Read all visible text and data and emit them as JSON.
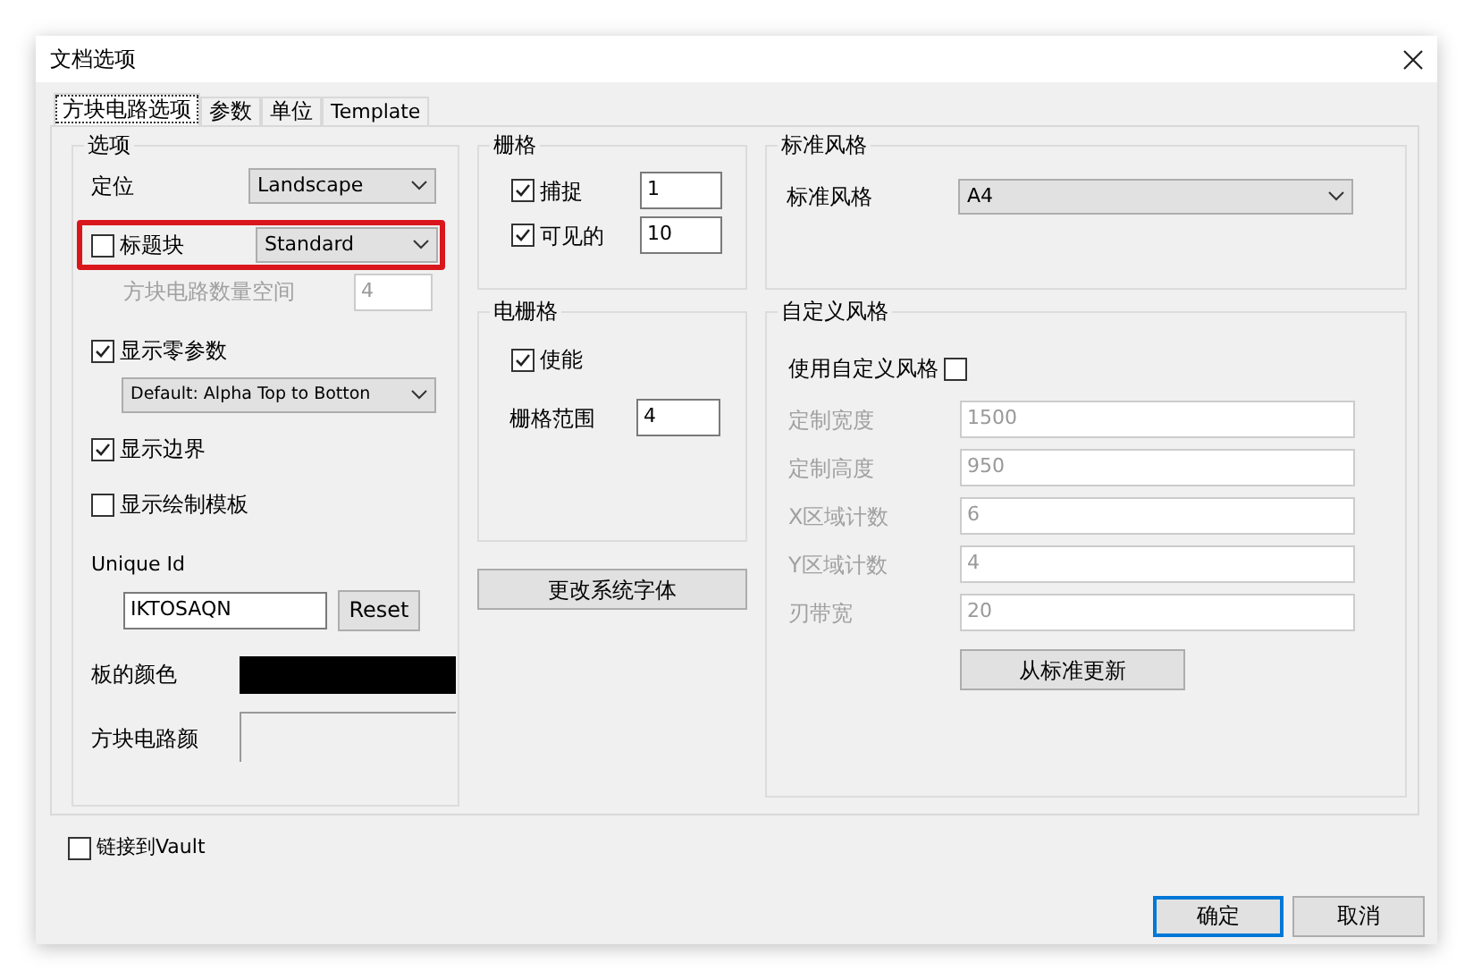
{
  "window": {
    "title": "文档选项"
  },
  "tabs": [
    {
      "label": "方块电路选项",
      "selected": true
    },
    {
      "label": "参数",
      "selected": false
    },
    {
      "label": "单位",
      "selected": false
    },
    {
      "label": "Template",
      "selected": false
    }
  ],
  "options": {
    "title": "选项",
    "orientation": {
      "label": "定位",
      "value": "Landscape"
    },
    "title_block": {
      "label": "标题块",
      "checked": false,
      "value": "Standard",
      "highlighted": true
    },
    "sheet_number_spaces": {
      "label": "方块电路数量空间",
      "value": "4",
      "disabled": true
    },
    "show_zero_params": {
      "label": "显示零参数",
      "checked": true
    },
    "param_order": {
      "value": "Default: Alpha Top to Botton"
    },
    "show_border": {
      "label": "显示边界",
      "checked": true
    },
    "show_template": {
      "label": "显示绘制模板",
      "checked": false
    },
    "unique_id": {
      "label": "Unique Id",
      "value": "IKTOSAQN",
      "button": "Reset"
    },
    "board_color": {
      "label": "板的颜色",
      "color": "#000000"
    },
    "sheet_color": {
      "label": "方块电路颜"
    }
  },
  "grid": {
    "title": "栅格",
    "rows": [
      {
        "label": "捕捉",
        "checked": true,
        "value": "1"
      },
      {
        "label": "可见的",
        "checked": true,
        "value": "10"
      }
    ]
  },
  "electrical_grid": {
    "title": "电栅格",
    "enable": {
      "label": "使能",
      "checked": true
    },
    "range": {
      "label": "栅格范围",
      "value": "4"
    }
  },
  "change_font_button": "更改系统字体",
  "standard_style": {
    "title": "标准风格",
    "label": "标准风格",
    "value": "A4"
  },
  "custom_style": {
    "title": "自定义风格",
    "use_custom": {
      "label": "使用自定义风格",
      "checked": false
    },
    "fields": [
      {
        "label": "定制宽度",
        "value": "1500",
        "disabled": true
      },
      {
        "label": "定制高度",
        "value": "950",
        "disabled": true
      },
      {
        "label": "X区域计数",
        "value": "6",
        "disabled": true
      },
      {
        "label": "Y区域计数",
        "value": "4",
        "disabled": true
      },
      {
        "label": "刃带宽",
        "value": "20",
        "disabled": true
      }
    ],
    "update_button": "从标准更新"
  },
  "link_vault": {
    "label": "链接到Vault",
    "checked": false
  },
  "buttons": [
    {
      "label": "确定",
      "default": true
    },
    {
      "label": "取消",
      "default": false
    }
  ]
}
